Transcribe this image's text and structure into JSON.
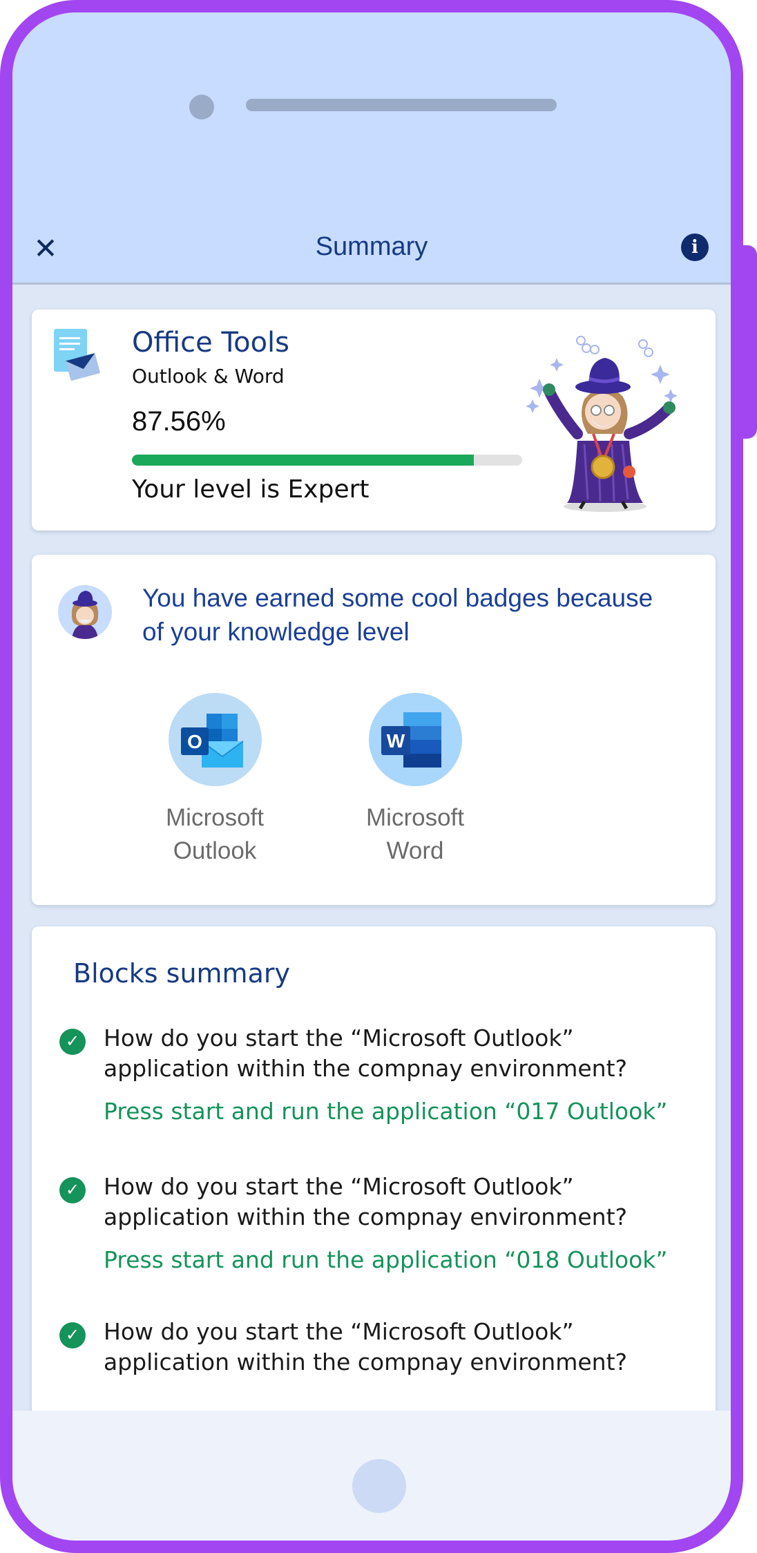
{
  "header": {
    "close_icon": "close-icon",
    "title": "Summary",
    "info_icon": "info-icon"
  },
  "course": {
    "title": "Office Tools",
    "subtitle": "Outlook & Word",
    "percent_text": "87.56%",
    "progress": 0.8756,
    "level_text": "Your level is Expert"
  },
  "badges": {
    "message": "You have earned some cool badges because of your knowledge level",
    "items": [
      {
        "line1": "Microsoft",
        "line2": "Outlook",
        "letter": "O",
        "icon": "outlook-icon"
      },
      {
        "line1": "Microsoft",
        "line2": "Word",
        "letter": "W",
        "icon": "word-icon"
      }
    ]
  },
  "blocks": {
    "title": "Blocks summary",
    "items": [
      {
        "question": "How do you start the “Microsoft Outlook” application within the compnay environment?",
        "answer": "Press start and run the application “017 Outlook”"
      },
      {
        "question": "How do you start the “Microsoft Outlook” application within the compnay environment?",
        "answer": "Press start and run the application “018 Outlook”"
      },
      {
        "question": "How do you start the “Microsoft Outlook” application within the compnay environment?",
        "answer": ""
      }
    ]
  },
  "colors": {
    "accent": "#173a82",
    "success": "#14935a",
    "frame": "#a146f0",
    "header_bg": "#c8dcff"
  }
}
